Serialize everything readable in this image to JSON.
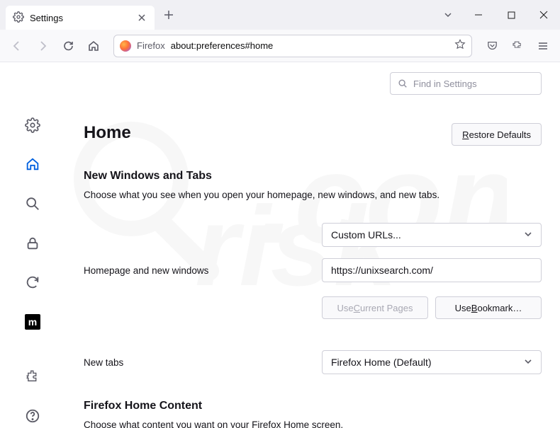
{
  "titlebar": {
    "tab_title": "Settings"
  },
  "urlbar": {
    "identity_label": "Firefox",
    "url": "about:preferences#home"
  },
  "search": {
    "placeholder": "Find in Settings"
  },
  "page": {
    "heading": "Home",
    "restore_defaults": "Restore Defaults"
  },
  "section1": {
    "title": "New Windows and Tabs",
    "desc": "Choose what you see when you open your homepage, new windows, and new tabs.",
    "homepage_label": "Homepage and new windows",
    "homepage_select": "Custom URLs...",
    "homepage_url": "https://unixsearch.com/",
    "use_current": "Use Current Pages",
    "use_bookmark": "Use Bookmark…",
    "newtabs_label": "New tabs",
    "newtabs_select": "Firefox Home (Default)"
  },
  "section2": {
    "title": "Firefox Home Content",
    "desc": "Choose what content you want on your Firefox Home screen."
  }
}
